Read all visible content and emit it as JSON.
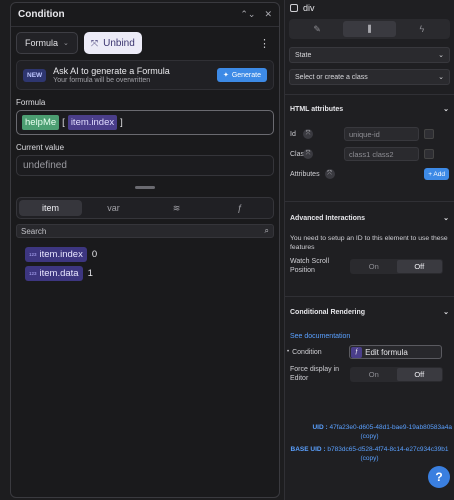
{
  "left_panel": {
    "title": "Condition",
    "formula_button": "Formula",
    "unbind_button": "Unbind",
    "ai_card": {
      "badge": "NEW",
      "title": "Ask AI to generate a Formula",
      "subtitle": "Your formula will be overwritten",
      "generate_label": "Generate"
    },
    "formula_label": "Formula",
    "formula_tokens": {
      "func": "helpMe",
      "open": "[",
      "arg": "item.index",
      "close": "]"
    },
    "current_value_label": "Current value",
    "current_value": "undefined",
    "tabs": {
      "item": "item",
      "var": "var"
    },
    "search_placeholder": "Search",
    "variables": [
      {
        "type": "123",
        "name": "item.index",
        "value": "0"
      },
      {
        "type": "123",
        "name": "item.data",
        "value": "1"
      }
    ]
  },
  "right_panel": {
    "element_name": "div",
    "state_label": "State",
    "class_select": "Select or create a class",
    "html_attributes": {
      "title": "HTML attributes",
      "id_label": "Id",
      "id_placeholder": "unique-id",
      "class_label": "Class",
      "class_placeholder": "class1 class2",
      "attributes_label": "Attributes",
      "add_label": "+ Add"
    },
    "advanced": {
      "title": "Advanced Interactions",
      "description": "You need to setup an ID to this element to use these features",
      "watch_scroll_label": "Watch Scroll Position",
      "toggle_on": "On",
      "toggle_off": "Off"
    },
    "conditional": {
      "title": "Conditional Rendering",
      "documentation_link": "See documentation",
      "condition_label": "Condition",
      "edit_formula": "Edit formula",
      "force_display_label": "Force display in Editor",
      "toggle_on": "On",
      "toggle_off": "Off"
    },
    "uid": {
      "uid_label": "UID :",
      "uid_value": "47fa23e0-d605-48d1-bae9-19ab80583a4a",
      "uid_copy": "(copy)",
      "base_uid_label": "BASE UID :",
      "base_uid_value": "b783dc65-d528-4f74-8c14-e27c934c39b1",
      "base_uid_copy": "(copy)"
    },
    "help_label": "?"
  }
}
